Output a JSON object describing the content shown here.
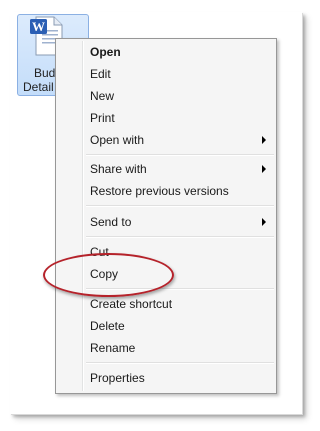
{
  "file": {
    "icon": "word-document-icon",
    "label_line1": "Bud",
    "label_line2": "Detail"
  },
  "menu": {
    "items": [
      {
        "label": "Open",
        "bold": true
      },
      {
        "label": "Edit"
      },
      {
        "label": "New"
      },
      {
        "label": "Print"
      },
      {
        "label": "Open with",
        "submenu": true
      },
      {
        "label": "Share with",
        "submenu": true
      },
      {
        "label": "Restore previous versions"
      },
      {
        "label": "Send to",
        "submenu": true
      },
      {
        "label": "Cut"
      },
      {
        "label": "Copy"
      },
      {
        "label": "Create shortcut"
      },
      {
        "label": "Delete"
      },
      {
        "label": "Rename"
      },
      {
        "label": "Properties"
      }
    ]
  },
  "highlight": {
    "target": "Copy",
    "color": "#b5222a"
  }
}
